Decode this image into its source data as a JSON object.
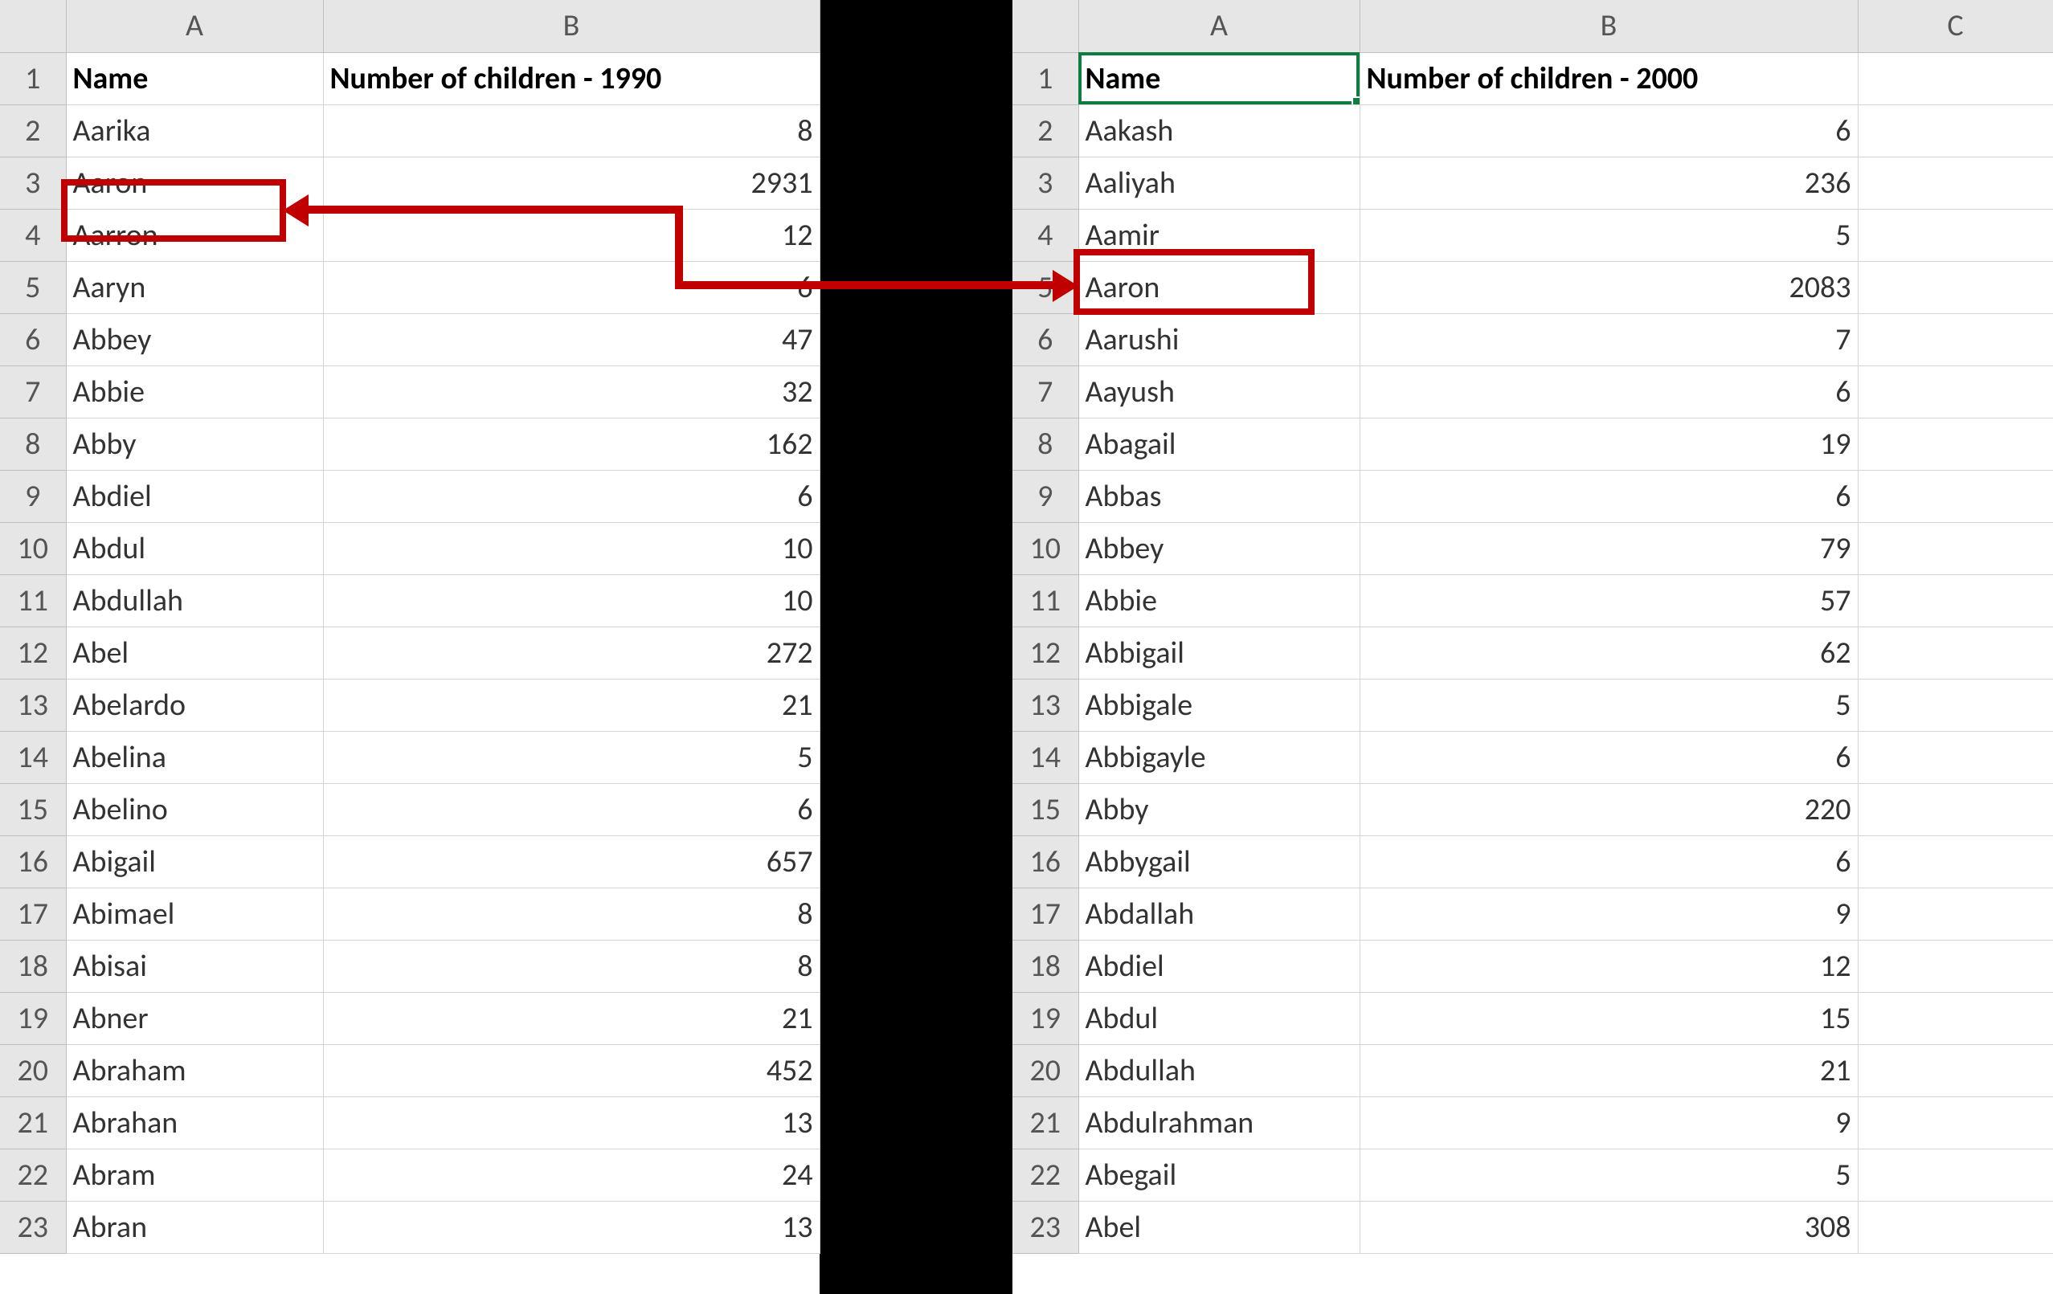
{
  "left": {
    "columns": [
      "A",
      "B"
    ],
    "header_row": [
      "Name",
      "Number of children - 1990"
    ],
    "rows": [
      {
        "n": 1
      },
      {
        "n": 2,
        "name": "Aarika",
        "val": "8"
      },
      {
        "n": 3,
        "name": "Aaron",
        "val": "2931"
      },
      {
        "n": 4,
        "name": "Aarron",
        "val": "12"
      },
      {
        "n": 5,
        "name": "Aaryn",
        "val": "6"
      },
      {
        "n": 6,
        "name": "Abbey",
        "val": "47"
      },
      {
        "n": 7,
        "name": "Abbie",
        "val": "32"
      },
      {
        "n": 8,
        "name": "Abby",
        "val": "162"
      },
      {
        "n": 9,
        "name": "Abdiel",
        "val": "6"
      },
      {
        "n": 10,
        "name": "Abdul",
        "val": "10"
      },
      {
        "n": 11,
        "name": "Abdullah",
        "val": "10"
      },
      {
        "n": 12,
        "name": "Abel",
        "val": "272"
      },
      {
        "n": 13,
        "name": "Abelardo",
        "val": "21"
      },
      {
        "n": 14,
        "name": "Abelina",
        "val": "5"
      },
      {
        "n": 15,
        "name": "Abelino",
        "val": "6"
      },
      {
        "n": 16,
        "name": "Abigail",
        "val": "657"
      },
      {
        "n": 17,
        "name": "Abimael",
        "val": "8"
      },
      {
        "n": 18,
        "name": "Abisai",
        "val": "8"
      },
      {
        "n": 19,
        "name": "Abner",
        "val": "21"
      },
      {
        "n": 20,
        "name": "Abraham",
        "val": "452"
      },
      {
        "n": 21,
        "name": "Abrahan",
        "val": "13"
      },
      {
        "n": 22,
        "name": "Abram",
        "val": "24"
      },
      {
        "n": 23,
        "name": "Abran",
        "val": "13"
      }
    ]
  },
  "right": {
    "columns": [
      "A",
      "B",
      "C"
    ],
    "header_row": [
      "Name",
      "Number of children - 2000",
      ""
    ],
    "rows": [
      {
        "n": 1
      },
      {
        "n": 2,
        "name": "Aakash",
        "val": "6"
      },
      {
        "n": 3,
        "name": "Aaliyah",
        "val": "236"
      },
      {
        "n": 4,
        "name": "Aamir",
        "val": "5"
      },
      {
        "n": 5,
        "name": "Aaron",
        "val": "2083"
      },
      {
        "n": 6,
        "name": "Aarushi",
        "val": "7"
      },
      {
        "n": 7,
        "name": "Aayush",
        "val": "6"
      },
      {
        "n": 8,
        "name": "Abagail",
        "val": "19"
      },
      {
        "n": 9,
        "name": "Abbas",
        "val": "6"
      },
      {
        "n": 10,
        "name": "Abbey",
        "val": "79"
      },
      {
        "n": 11,
        "name": "Abbie",
        "val": "57"
      },
      {
        "n": 12,
        "name": "Abbigail",
        "val": "62"
      },
      {
        "n": 13,
        "name": "Abbigale",
        "val": "5"
      },
      {
        "n": 14,
        "name": "Abbigayle",
        "val": "6"
      },
      {
        "n": 15,
        "name": "Abby",
        "val": "220"
      },
      {
        "n": 16,
        "name": "Abbygail",
        "val": "6"
      },
      {
        "n": 17,
        "name": "Abdallah",
        "val": "9"
      },
      {
        "n": 18,
        "name": "Abdiel",
        "val": "12"
      },
      {
        "n": 19,
        "name": "Abdul",
        "val": "15"
      },
      {
        "n": 20,
        "name": "Abdullah",
        "val": "21"
      },
      {
        "n": 21,
        "name": "Abdulrahman",
        "val": "9"
      },
      {
        "n": 22,
        "name": "Abegail",
        "val": "5"
      },
      {
        "n": 23,
        "name": "Abel",
        "val": "308"
      }
    ]
  },
  "selection": {
    "pane": "right",
    "cell": "A1"
  },
  "annotation": {
    "highlight_left": {
      "pane": "left",
      "row": 3,
      "col": "A",
      "label": "Aaron"
    },
    "highlight_right": {
      "pane": "right",
      "row": 5,
      "col": "A",
      "label": "Aaron"
    }
  }
}
